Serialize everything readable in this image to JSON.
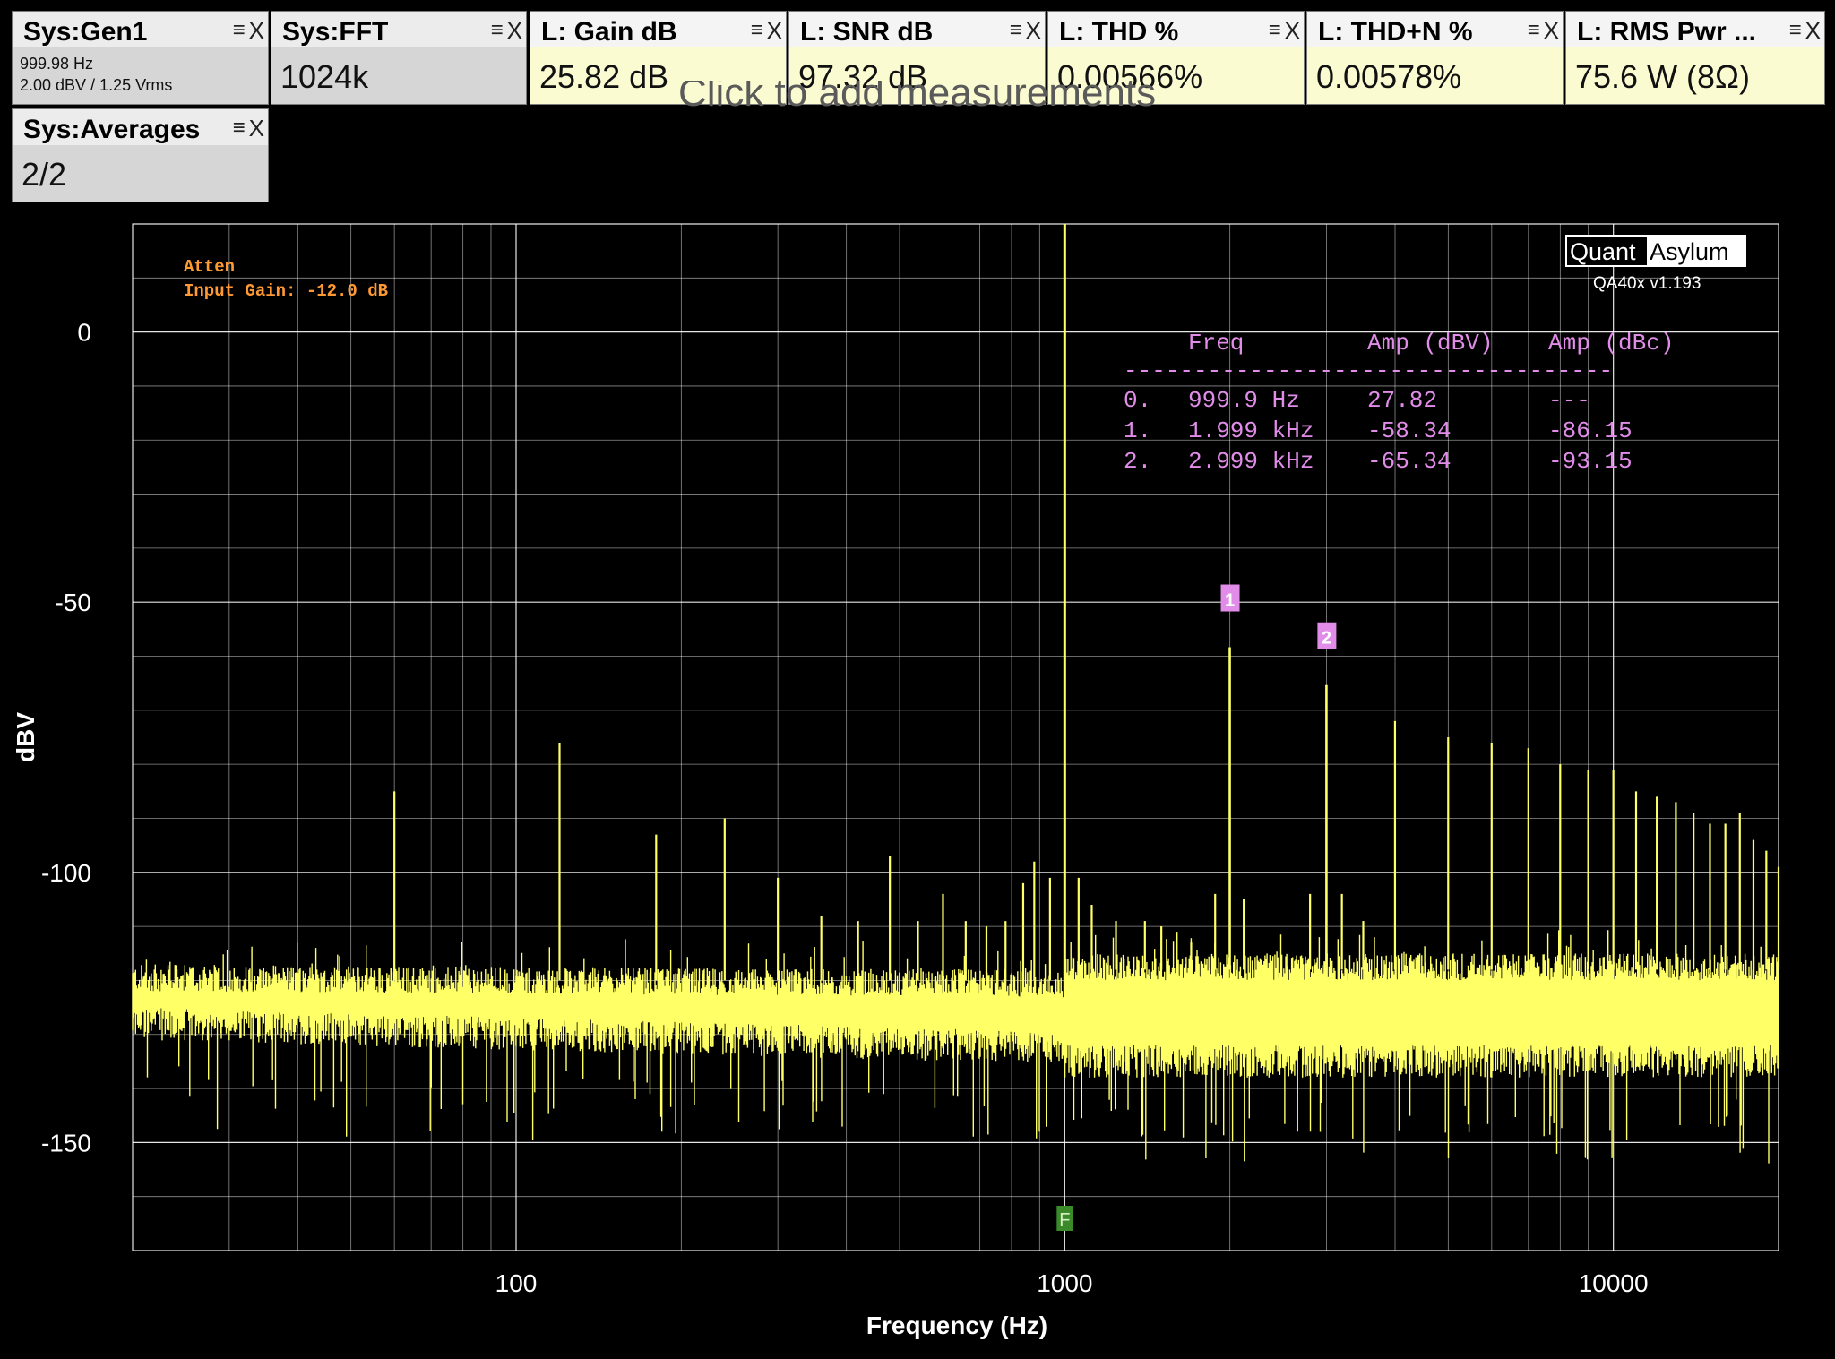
{
  "tiles": [
    {
      "id": "sys-gen1",
      "title": "Sys:Gen1",
      "kind": "sys",
      "lines": [
        "999.98 Hz",
        "2.00 dBV  / 1.25 Vrms"
      ]
    },
    {
      "id": "sys-fft",
      "title": "Sys:FFT",
      "kind": "sys",
      "value": "1024k"
    },
    {
      "id": "l-gain",
      "title": "L: Gain dB",
      "kind": "ch",
      "value": "25.82 dB"
    },
    {
      "id": "l-snr",
      "title": "L: SNR dB",
      "kind": "ch",
      "value": "97.32 dB"
    },
    {
      "id": "l-thd",
      "title": "L: THD %",
      "kind": "ch",
      "value": "0.00566%"
    },
    {
      "id": "l-thdn",
      "title": "L: THD+N %",
      "kind": "ch",
      "value": "0.00578%"
    },
    {
      "id": "l-rms",
      "title": "L: RMS Pwr ...",
      "kind": "ch",
      "value": "75.6 W (8Ω)"
    },
    {
      "id": "sys-avg",
      "title": "Sys:Averages",
      "kind": "sys",
      "value": "2/2"
    }
  ],
  "tile_buttons": {
    "menu": "≡",
    "close": "X"
  },
  "add_measurement_hint": "Click to add measurements",
  "chart_data": {
    "type": "line",
    "xlabel": "Frequency (Hz)",
    "ylabel": "dBV",
    "x_scale": "log",
    "xlim": [
      20,
      20000
    ],
    "ylim": [
      -170,
      20
    ],
    "x_ticks": [
      100,
      1000,
      10000
    ],
    "y_ticks": [
      0,
      -50,
      -100,
      -150
    ],
    "grid": true,
    "colors": {
      "trace": "#ffff66",
      "grid": "#ffffff",
      "annotation": "#ff9933",
      "marker": "#e08ce8",
      "fundamental_flag": "#3a8a2a"
    },
    "annotations": [
      "Atten",
      "Input Gain: -12.0 dB"
    ],
    "brand": {
      "left": "Quant",
      "right": "Asylum",
      "version": "QA40x v1.193"
    },
    "fundamental_flag": {
      "label": "F",
      "x": 1000
    },
    "harmonic_table": {
      "headers": [
        "Freq",
        "Amp (dBV)",
        "Amp (dBc)"
      ],
      "divider": "-----------------------------------",
      "rows": [
        {
          "idx": "0.",
          "freq": "999.9 Hz",
          "dbv": "27.82",
          "dbc": "---"
        },
        {
          "idx": "1.",
          "freq": "1.999 kHz",
          "dbv": "-58.34",
          "dbc": "-86.15"
        },
        {
          "idx": "2.",
          "freq": "2.999 kHz",
          "dbv": "-65.34",
          "dbc": "-93.15"
        }
      ]
    },
    "harmonic_markers": [
      {
        "label": "1",
        "x": 1999,
        "y": -58.34
      },
      {
        "label": "2",
        "x": 2999,
        "y": -65.34
      }
    ],
    "fundamental": {
      "x": 999.9,
      "y": 27.82
    },
    "spurs": [
      {
        "x": 60,
        "y": -85
      },
      {
        "x": 120,
        "y": -76
      },
      {
        "x": 180,
        "y": -93
      },
      {
        "x": 240,
        "y": -90
      },
      {
        "x": 300,
        "y": -101
      },
      {
        "x": 360,
        "y": -108
      },
      {
        "x": 420,
        "y": -109
      },
      {
        "x": 480,
        "y": -97
      },
      {
        "x": 540,
        "y": -109
      },
      {
        "x": 600,
        "y": -104
      },
      {
        "x": 660,
        "y": -109
      },
      {
        "x": 720,
        "y": -110
      },
      {
        "x": 780,
        "y": -109
      },
      {
        "x": 840,
        "y": -102
      },
      {
        "x": 880,
        "y": -98
      },
      {
        "x": 940,
        "y": -101
      },
      {
        "x": 1060,
        "y": -101
      },
      {
        "x": 1120,
        "y": -106
      },
      {
        "x": 1240,
        "y": -109
      },
      {
        "x": 1400,
        "y": -109
      },
      {
        "x": 1500,
        "y": -110
      },
      {
        "x": 1600,
        "y": -111
      },
      {
        "x": 1700,
        "y": -113
      },
      {
        "x": 1880,
        "y": -104
      },
      {
        "x": 2120,
        "y": -105
      },
      {
        "x": 2800,
        "y": -104
      },
      {
        "x": 3200,
        "y": -104
      },
      {
        "x": 3500,
        "y": -109
      },
      {
        "x": 3999,
        "y": -72
      },
      {
        "x": 4999,
        "y": -75
      },
      {
        "x": 5999,
        "y": -76
      },
      {
        "x": 6999,
        "y": -77
      },
      {
        "x": 7999,
        "y": -80
      },
      {
        "x": 8999,
        "y": -81
      },
      {
        "x": 9999,
        "y": -81
      },
      {
        "x": 10999,
        "y": -85
      },
      {
        "x": 11999,
        "y": -86
      },
      {
        "x": 12999,
        "y": -87
      },
      {
        "x": 13999,
        "y": -89
      },
      {
        "x": 14999,
        "y": -91
      },
      {
        "x": 15999,
        "y": -91
      },
      {
        "x": 16999,
        "y": -89
      },
      {
        "x": 17999,
        "y": -94
      },
      {
        "x": 18999,
        "y": -96
      },
      {
        "x": 19999,
        "y": -99
      }
    ],
    "noise_floor": {
      "low_band_top": -120,
      "low_band_bottom": -131,
      "high_band_top": -118,
      "high_band_bottom": -138
    }
  }
}
